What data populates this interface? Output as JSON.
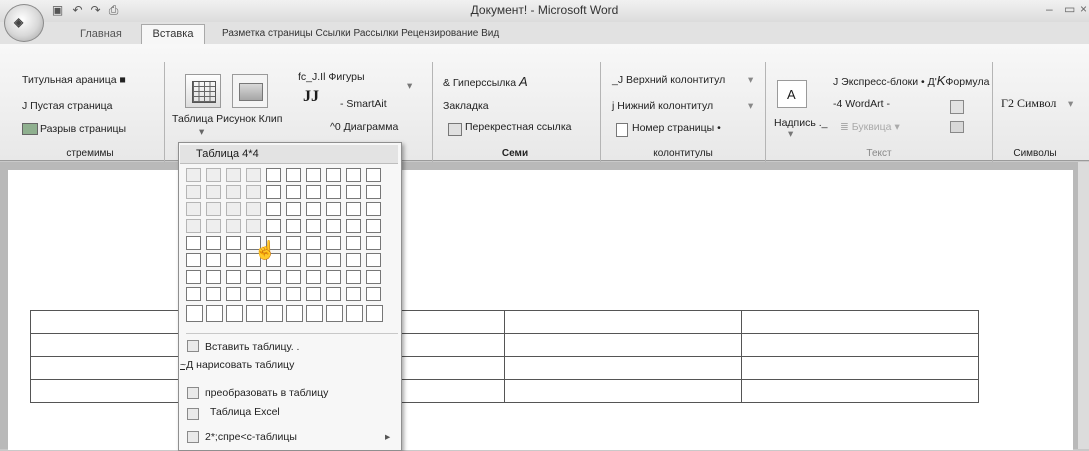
{
  "window": {
    "title": "Документ! - Microsoft Word",
    "minimize_icon": "minimize-icon",
    "maximize_icon": "maximize-icon",
    "close_icon": "close-icon"
  },
  "quick_access": [
    "save-icon",
    "undo-icon",
    "redo-icon",
    "print-icon"
  ],
  "tabs": {
    "home": "Главная",
    "insert": "Вставка",
    "rest": "Разметка страницы Ссылки Рассылки Рецензирование Вид"
  },
  "ribbon": {
    "pages": {
      "cover": "Титульная араница ■",
      "blank": "J Пустая страница",
      "break": "Разрыв страницы",
      "label": "стремимы"
    },
    "tables": {
      "label": "Таблица Рисунок Клип"
    },
    "illustrations": {
      "shapes": "fc_J.Il Фигуры",
      "jj": "JJ",
      "smartart": "- SmartAit",
      "chart": "^0 Диаграмма"
    },
    "links": {
      "hyperlink": "& Гиперссылка",
      "hyperlink_mark": "A",
      "bookmark": "Закладка",
      "crossref": "Перекрестная ссылка",
      "label": "Семи"
    },
    "header_footer": {
      "header": "_J Верхний колонтитул",
      "footer": "j Нижний колонтитул",
      "page_number": "Номер страницы •",
      "label": "колонтитулы"
    },
    "text": {
      "quick_parts": "J Экспресс-блоки • Д'",
      "k_mark": "K",
      "formula": "Формула",
      "wordart": "-4 WordArt -",
      "textbox": "Надпись ._",
      "dropcap": "Буквица",
      "label": "Текст"
    },
    "symbols": {
      "symbol": "Г2 Символ",
      "label": "Символы"
    }
  },
  "dropdown": {
    "title": "Таблица 4*4",
    "grid_cols": 10,
    "grid_rows": 8,
    "selected_cols": 4,
    "selected_rows": 4,
    "items": {
      "insert_table": "Вставить таблицу. .",
      "draw_table": "нарисовать таблицу",
      "draw_prefix": "~Д",
      "convert": "преобразовать в таблицу",
      "excel": "Таблица Excel",
      "quick": "2*;спре<с-таблицы"
    }
  }
}
